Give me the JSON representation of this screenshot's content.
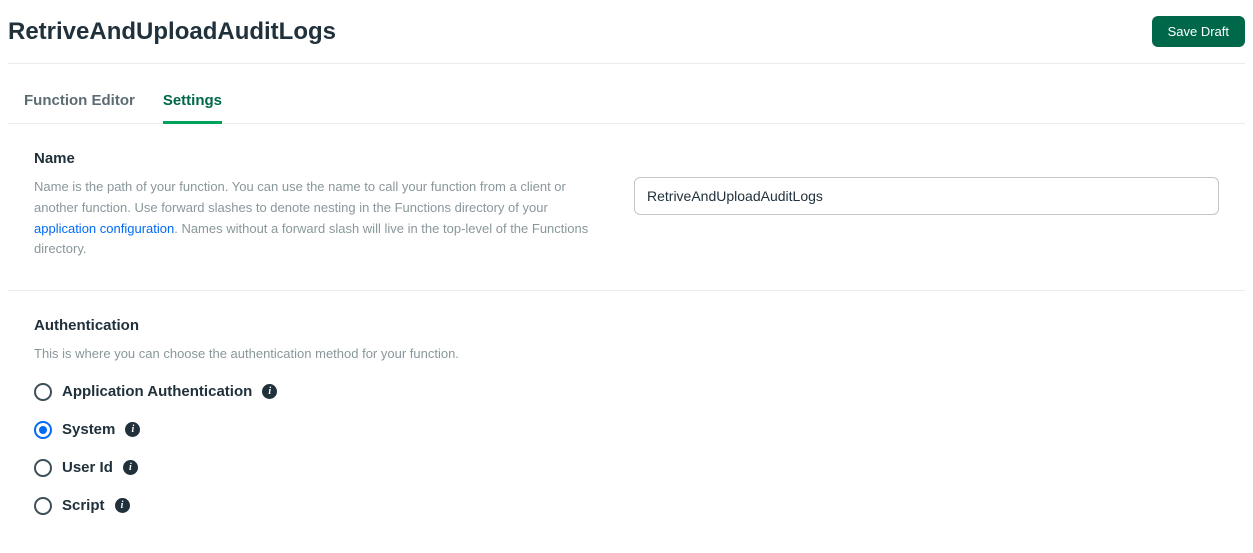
{
  "header": {
    "title": "RetriveAndUploadAuditLogs",
    "save_label": "Save Draft"
  },
  "tabs": [
    {
      "label": "Function Editor",
      "active": false
    },
    {
      "label": "Settings",
      "active": true
    }
  ],
  "name_section": {
    "title": "Name",
    "desc_part1": "Name is the path of your function. You can use the name to call your function from a client or another function. Use forward slashes to denote nesting in the Functions directory of your ",
    "link_text": "application configuration",
    "desc_part2": ". Names without a forward slash will live in the top-level of the Functions directory.",
    "input_value": "RetriveAndUploadAuditLogs"
  },
  "auth_section": {
    "title": "Authentication",
    "desc": "This is where you can choose the authentication method for your function.",
    "options": [
      {
        "label": "Application Authentication",
        "selected": false
      },
      {
        "label": "System",
        "selected": true
      },
      {
        "label": "User Id",
        "selected": false
      },
      {
        "label": "Script",
        "selected": false
      }
    ]
  }
}
